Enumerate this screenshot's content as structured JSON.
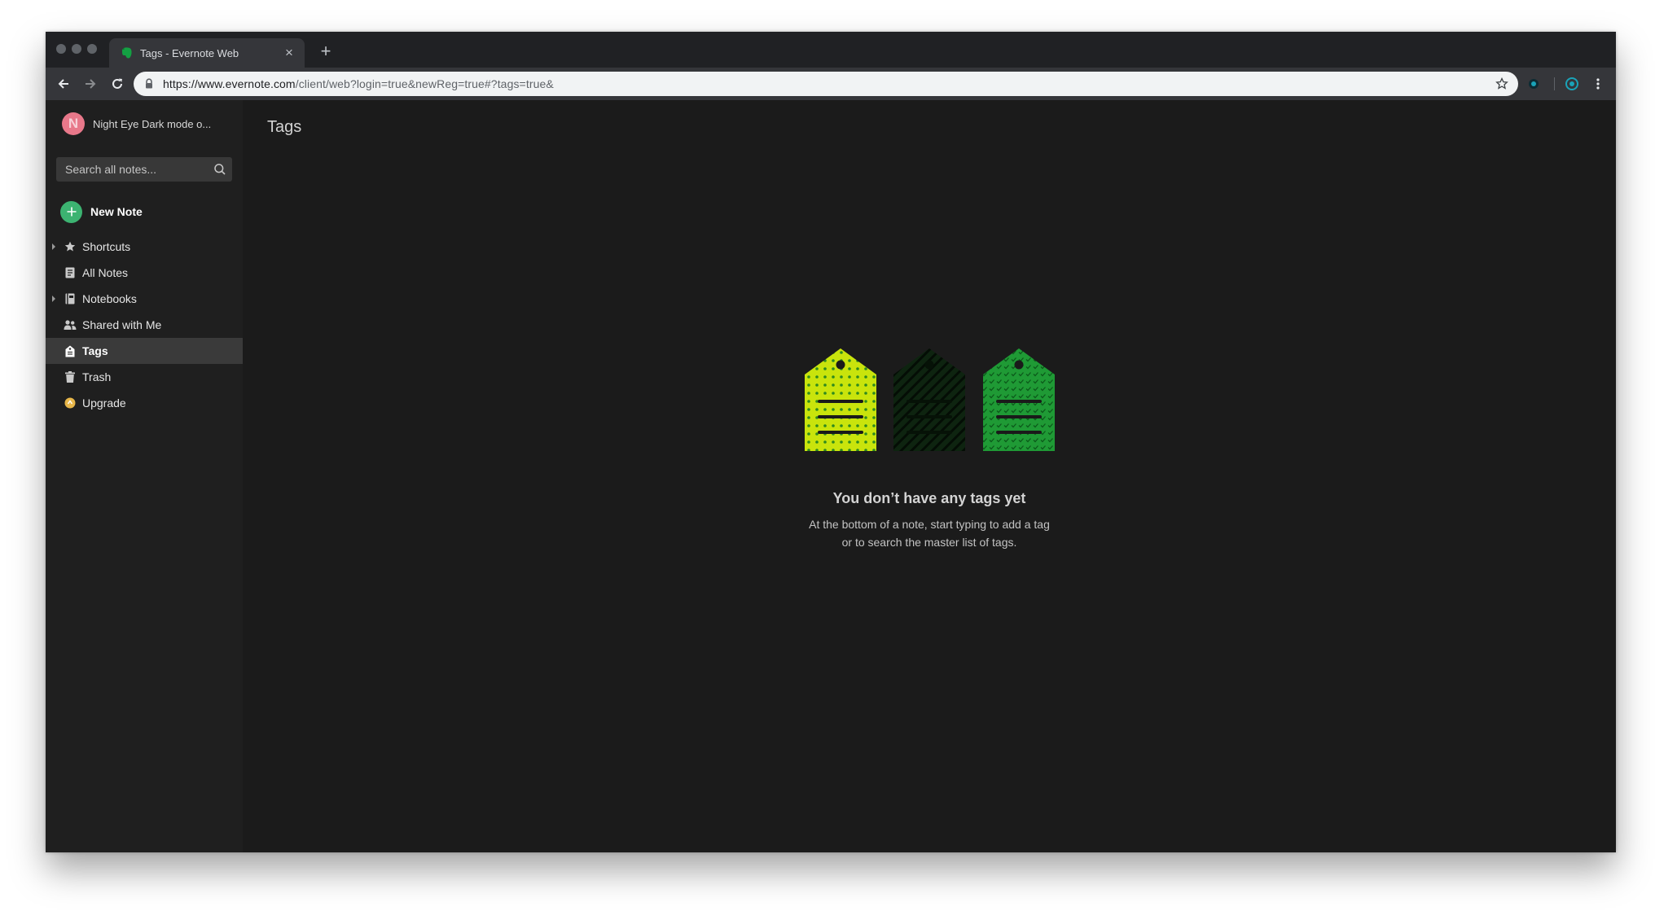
{
  "browser": {
    "tab_title": "Tags - Evernote Web",
    "tab_close_symbol": "×",
    "new_tab_symbol": "+",
    "url_host": "https://www.evernote.com",
    "url_path": "/client/web?login=true&newReg=true#?tags=true&"
  },
  "account": {
    "avatar_initial": "N",
    "name": "Night Eye Dark mode o..."
  },
  "search": {
    "placeholder": "Search all notes..."
  },
  "new_note": {
    "label": "New Note"
  },
  "nav": {
    "shortcuts": "Shortcuts",
    "all_notes": "All Notes",
    "notebooks": "Notebooks",
    "shared": "Shared with Me",
    "tags": "Tags",
    "trash": "Trash",
    "upgrade": "Upgrade"
  },
  "main": {
    "title": "Tags",
    "empty_title": "You don’t have any tags yet",
    "empty_line1": "At the bottom of a note, start typing to add a tag",
    "empty_line2": "or to search the master list of tags."
  },
  "colors": {
    "accent_green": "#3cb371",
    "tag_yellow": "#c9e40c",
    "tag_dark": "#0e2410",
    "tag_green": "#1f9a35",
    "upgrade_badge": "#e8b74a"
  },
  "icons": {
    "favicon": "evernote-elephant-icon",
    "search": "search-icon",
    "shortcuts": "star-icon",
    "all_notes": "note-icon",
    "notebooks": "notebook-icon",
    "shared": "people-icon",
    "tags": "tag-icon",
    "trash": "trash-icon",
    "upgrade": "upgrade-badge-icon"
  }
}
